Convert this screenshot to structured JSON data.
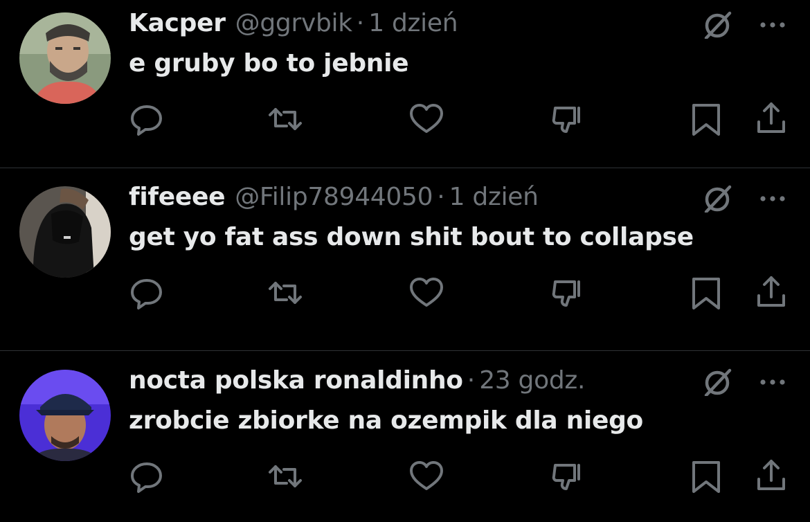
{
  "replies": [
    {
      "name": "Kacper",
      "handle": "@ggrvbik",
      "separator": "·",
      "time": "1 dzień",
      "text": "e gruby bo to jebnie",
      "avatar": "man-with-beard-photo"
    },
    {
      "name": "fifeeee",
      "handle": "@Filip78944050",
      "separator": "·",
      "time": "1 dzień",
      "text": "get yo fat ass down shit bout to collapse",
      "avatar": "person-in-black-hoodie-photo"
    },
    {
      "name": "nocta polska ronaldinho",
      "handle": "",
      "separator": "·",
      "time": "23 godz.",
      "text": "zrobcie zbiorke na ozempik dla niego",
      "avatar": "man-in-cap-purple-light-photo"
    }
  ],
  "icons": {
    "grok": "grok-icon",
    "more": "more-options-icon",
    "reply": "reply-icon",
    "retweet": "retweet-icon",
    "like": "heart-icon",
    "dislike": "dislike-icon",
    "bookmark": "bookmark-icon",
    "share": "share-icon"
  },
  "colors": {
    "background": "#000000",
    "text": "#e7e9ea",
    "secondary": "#71767b",
    "divider": "#2f3336"
  }
}
